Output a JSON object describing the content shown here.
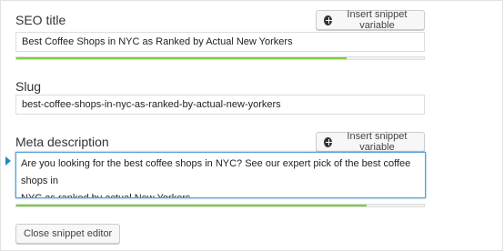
{
  "seo_title": {
    "label": "SEO title",
    "insert_button_label": "Insert snippet variable",
    "value": "Best Coffee Shops in NYC as Ranked by Actual New Yorkers",
    "progress_percent": 81,
    "progress_color": "#7ad03a"
  },
  "slug": {
    "label": "Slug",
    "value": "best-coffee-shops-in-nyc-as-ranked-by-actual-new-yorkers"
  },
  "meta_description": {
    "label": "Meta description",
    "insert_button_label": "Insert snippet variable",
    "value_lines": [
      "Are you looking for the best coffee shops in NYC? See our expert pick of the best coffee shops in",
      "NYC as ranked by actual New Yorkers."
    ],
    "progress_percent": 86,
    "progress_color": "#7ad03a"
  },
  "close_button_label": "Close snippet editor",
  "icons": {
    "insert": "plus-circle-icon",
    "focus_indicator": "triangle-right-icon"
  },
  "colors": {
    "focus_border": "#5b9dd9",
    "focus_arrow": "#1e8cbe",
    "progress_good": "#7ad03a"
  }
}
